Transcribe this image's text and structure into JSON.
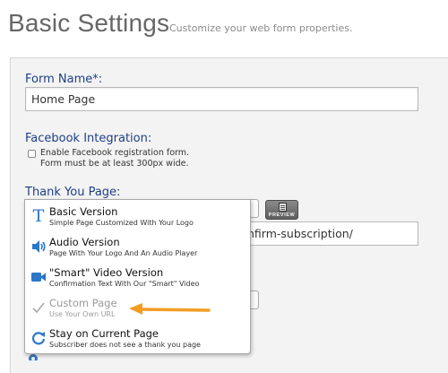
{
  "header": {
    "title": "Basic Settings",
    "subtitle": "Customize your web form properties."
  },
  "form": {
    "form_name": {
      "label": "Form Name*:",
      "value": "Home Page"
    },
    "facebook": {
      "label": "Facebook Integration:",
      "checkbox_label": "Enable Facebook registration form.",
      "note": "Form must be at least 300px wide.",
      "checked": false
    },
    "thank_you": {
      "label": "Thank You Page:",
      "url_value": "nfirm-subscription/",
      "preview_label": "PREVIEW"
    }
  },
  "dropdown": {
    "options": [
      {
        "title": "Basic Version",
        "description": "Simple Page Customized With Your Logo",
        "icon": "text-t-icon",
        "enabled": true
      },
      {
        "title": "Audio Version",
        "description": "Page With Your Logo And An Audio Player",
        "icon": "speaker-icon",
        "enabled": true
      },
      {
        "title": "\"Smart\" Video Version",
        "description": "Confirmation Text With Our \"Smart\" Video",
        "icon": "video-camera-icon",
        "enabled": true
      },
      {
        "title": "Custom Page",
        "description": "Use Your Own URL",
        "icon": "checkmark-icon",
        "enabled": false
      },
      {
        "title": "Stay on Current Page",
        "description": "Subscriber does not see a thank you page",
        "icon": "refresh-icon",
        "enabled": true
      }
    ]
  },
  "colors": {
    "label_blue": "#1e3f86",
    "arrow_orange": "#f39c24",
    "icon_blue": "#2a77c9"
  }
}
